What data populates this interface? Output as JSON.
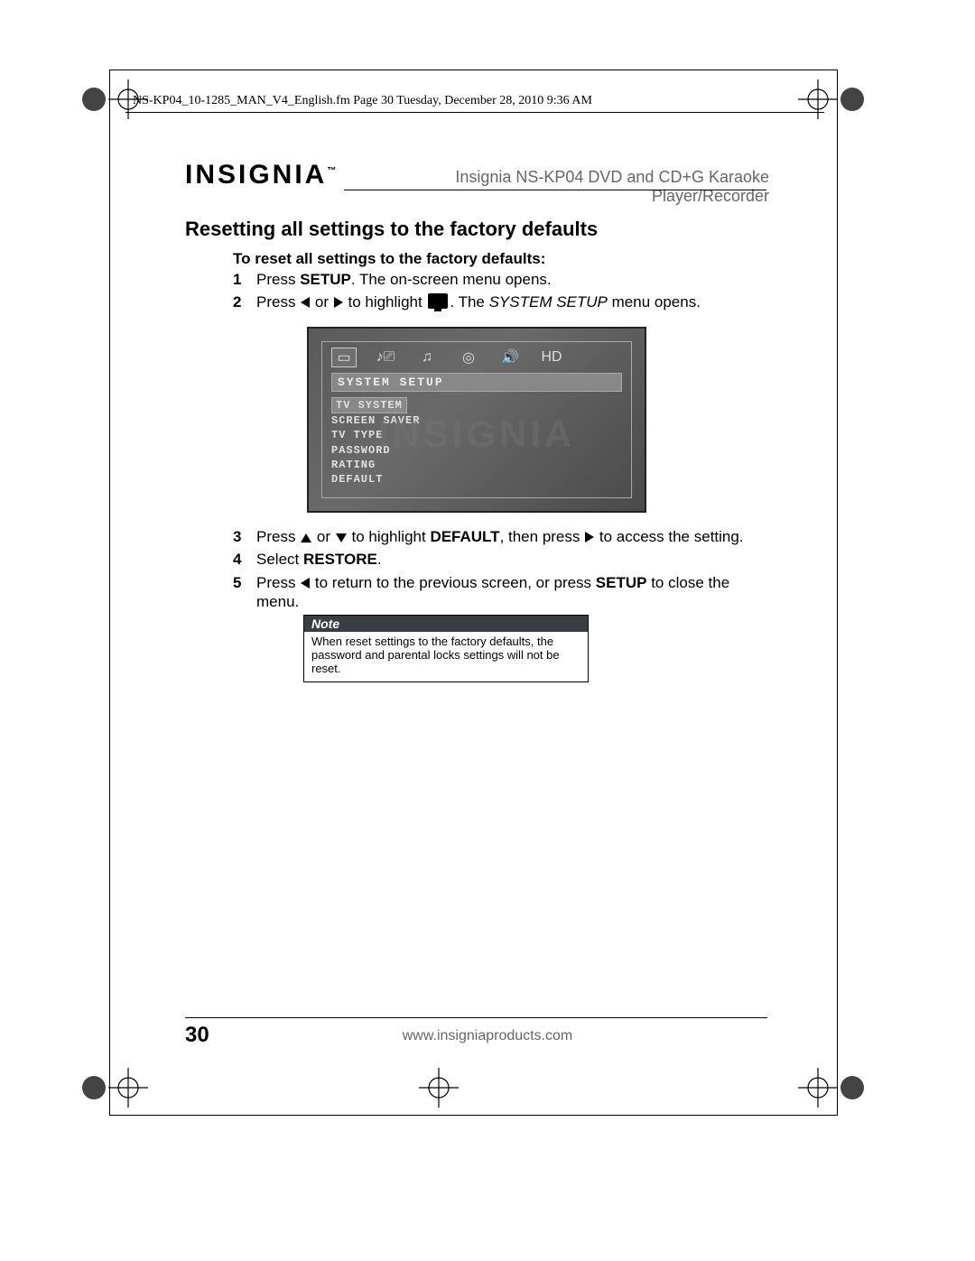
{
  "header_line": "NS-KP04_10-1285_MAN_V4_English.fm  Page 30  Tuesday, December 28, 2010  9:36 AM",
  "brand": "INSIGNIA",
  "brand_tm": "™",
  "product_name": "Insignia NS-KP04 DVD and CD+G Karaoke Player/Recorder",
  "section_heading": "Resetting all settings to the factory defaults",
  "sub_heading": "To reset all settings to the factory defaults:",
  "steps": {
    "s1_num": "1",
    "s1_a": "Press ",
    "s1_b": "SETUP",
    "s1_c": ". The on-screen menu opens.",
    "s2_num": "2",
    "s2_a": "Press ",
    "s2_or": " or ",
    "s2_b": " to highlight ",
    "s2_c": ". The ",
    "s2_d": "SYSTEM SETUP",
    "s2_e": " menu opens.",
    "s3_num": "3",
    "s3_a": "Press ",
    "s3_or": " or ",
    "s3_b": " to highlight ",
    "s3_c": "DEFAULT",
    "s3_d": ", then press ",
    "s3_e": " to access the setting.",
    "s4_num": "4",
    "s4_a": "Select ",
    "s4_b": "RESTORE",
    "s4_c": ".",
    "s5_num": "5",
    "s5_a": "Press ",
    "s5_b": " to return to the previous screen, or press ",
    "s5_c": "SETUP",
    "s5_d": " to close the menu."
  },
  "osd": {
    "title": "SYSTEM SETUP",
    "items": [
      "TV SYSTEM",
      "SCREEN SAVER",
      "TV TYPE",
      "PASSWORD",
      "RATING",
      "DEFAULT"
    ],
    "watermark": "INSIGNIA"
  },
  "note": {
    "label": "Note",
    "body": "When reset settings to the factory defaults, the password and parental locks settings will not be reset."
  },
  "page_number": "30",
  "footer_url": "www.insigniaproducts.com"
}
